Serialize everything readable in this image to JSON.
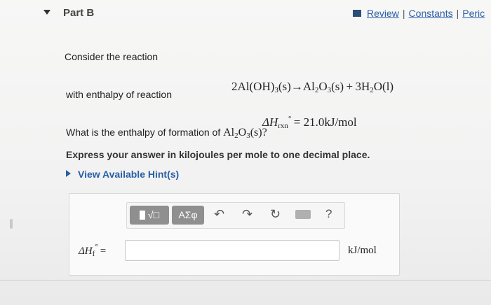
{
  "header": {
    "part_title": "Part B",
    "links": [
      "Review",
      "Constants",
      "Peric"
    ]
  },
  "question": {
    "consider": "Consider the reaction",
    "reaction": {
      "lhs_coef": "2",
      "lhs_species": "Al(OH)",
      "lhs_sub": "3",
      "lhs_state": "(s)",
      "arrow": "→",
      "p1_a": "Al",
      "p1_sub_a": "2",
      "p1_b": "O",
      "p1_sub_b": "3",
      "p1_state": "(s)",
      "plus": "+",
      "p2_coef": "3H",
      "p2_sub": "2",
      "p2_rest": "O(l)"
    },
    "with_enthalpy": "with enthalpy of reaction",
    "dh_symbol": "ΔH",
    "dh_sub": "rxn",
    "dh_value": "= 21.0kJ/mol",
    "ask": "What is the enthalpy of formation of",
    "ask_sp_a": "Al",
    "ask_sub_a": "2",
    "ask_sp_b": "O",
    "ask_sub_b": "3",
    "ask_tail": "(s)?",
    "instruction": "Express your answer in kilojoules per mole to one decimal place.",
    "hint_link": "View Available Hint(s)"
  },
  "answer": {
    "toolbar": {
      "templates_label": "√□",
      "symbols_label": "ΑΣφ",
      "help_label": "?"
    },
    "label_symbol": "ΔH",
    "label_sub": "f",
    "label_eq": "=",
    "input_value": "",
    "unit": "kJ/mol"
  }
}
